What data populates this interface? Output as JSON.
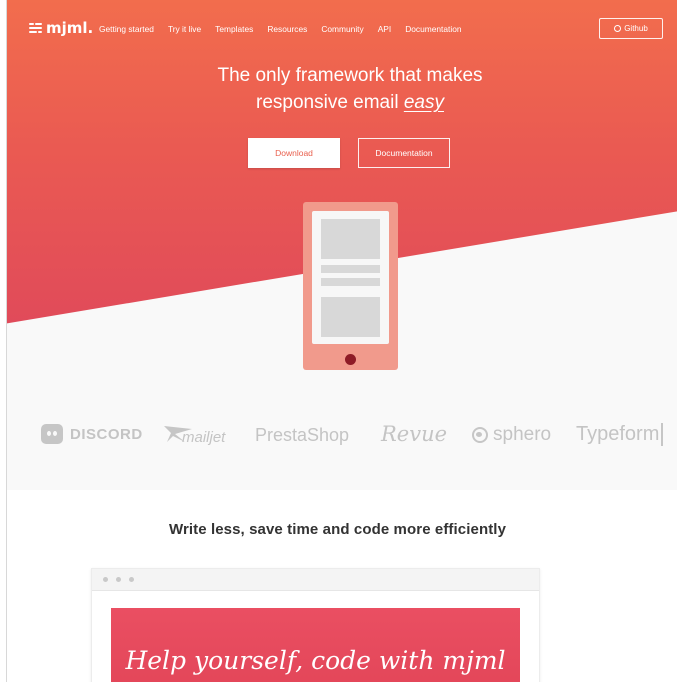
{
  "colors": {
    "hero_top": "#f26d4d",
    "hero_bottom": "#e04a5a",
    "accent": "#e9604e",
    "phone": "#f19a8c",
    "phone_button": "#8e1b26"
  },
  "nav": {
    "logo_text": "mjml.",
    "links": [
      "Getting started",
      "Try it live",
      "Templates",
      "Resources",
      "Community",
      "API",
      "Documentation"
    ],
    "github_label": "Github"
  },
  "hero": {
    "headline_line1": "The only framework that makes",
    "headline_line2_prefix": "responsive email ",
    "headline_emphasis": "easy",
    "download_label": "Download",
    "documentation_label": "Documentation"
  },
  "partners": [
    "DISCORD",
    "mailjet",
    "PrestaShop",
    "Revue",
    "sphero",
    "Typeform"
  ],
  "section": {
    "title": "Write less, save time and code more efficiently",
    "preview_text": "Help yourself, code with mjml"
  }
}
